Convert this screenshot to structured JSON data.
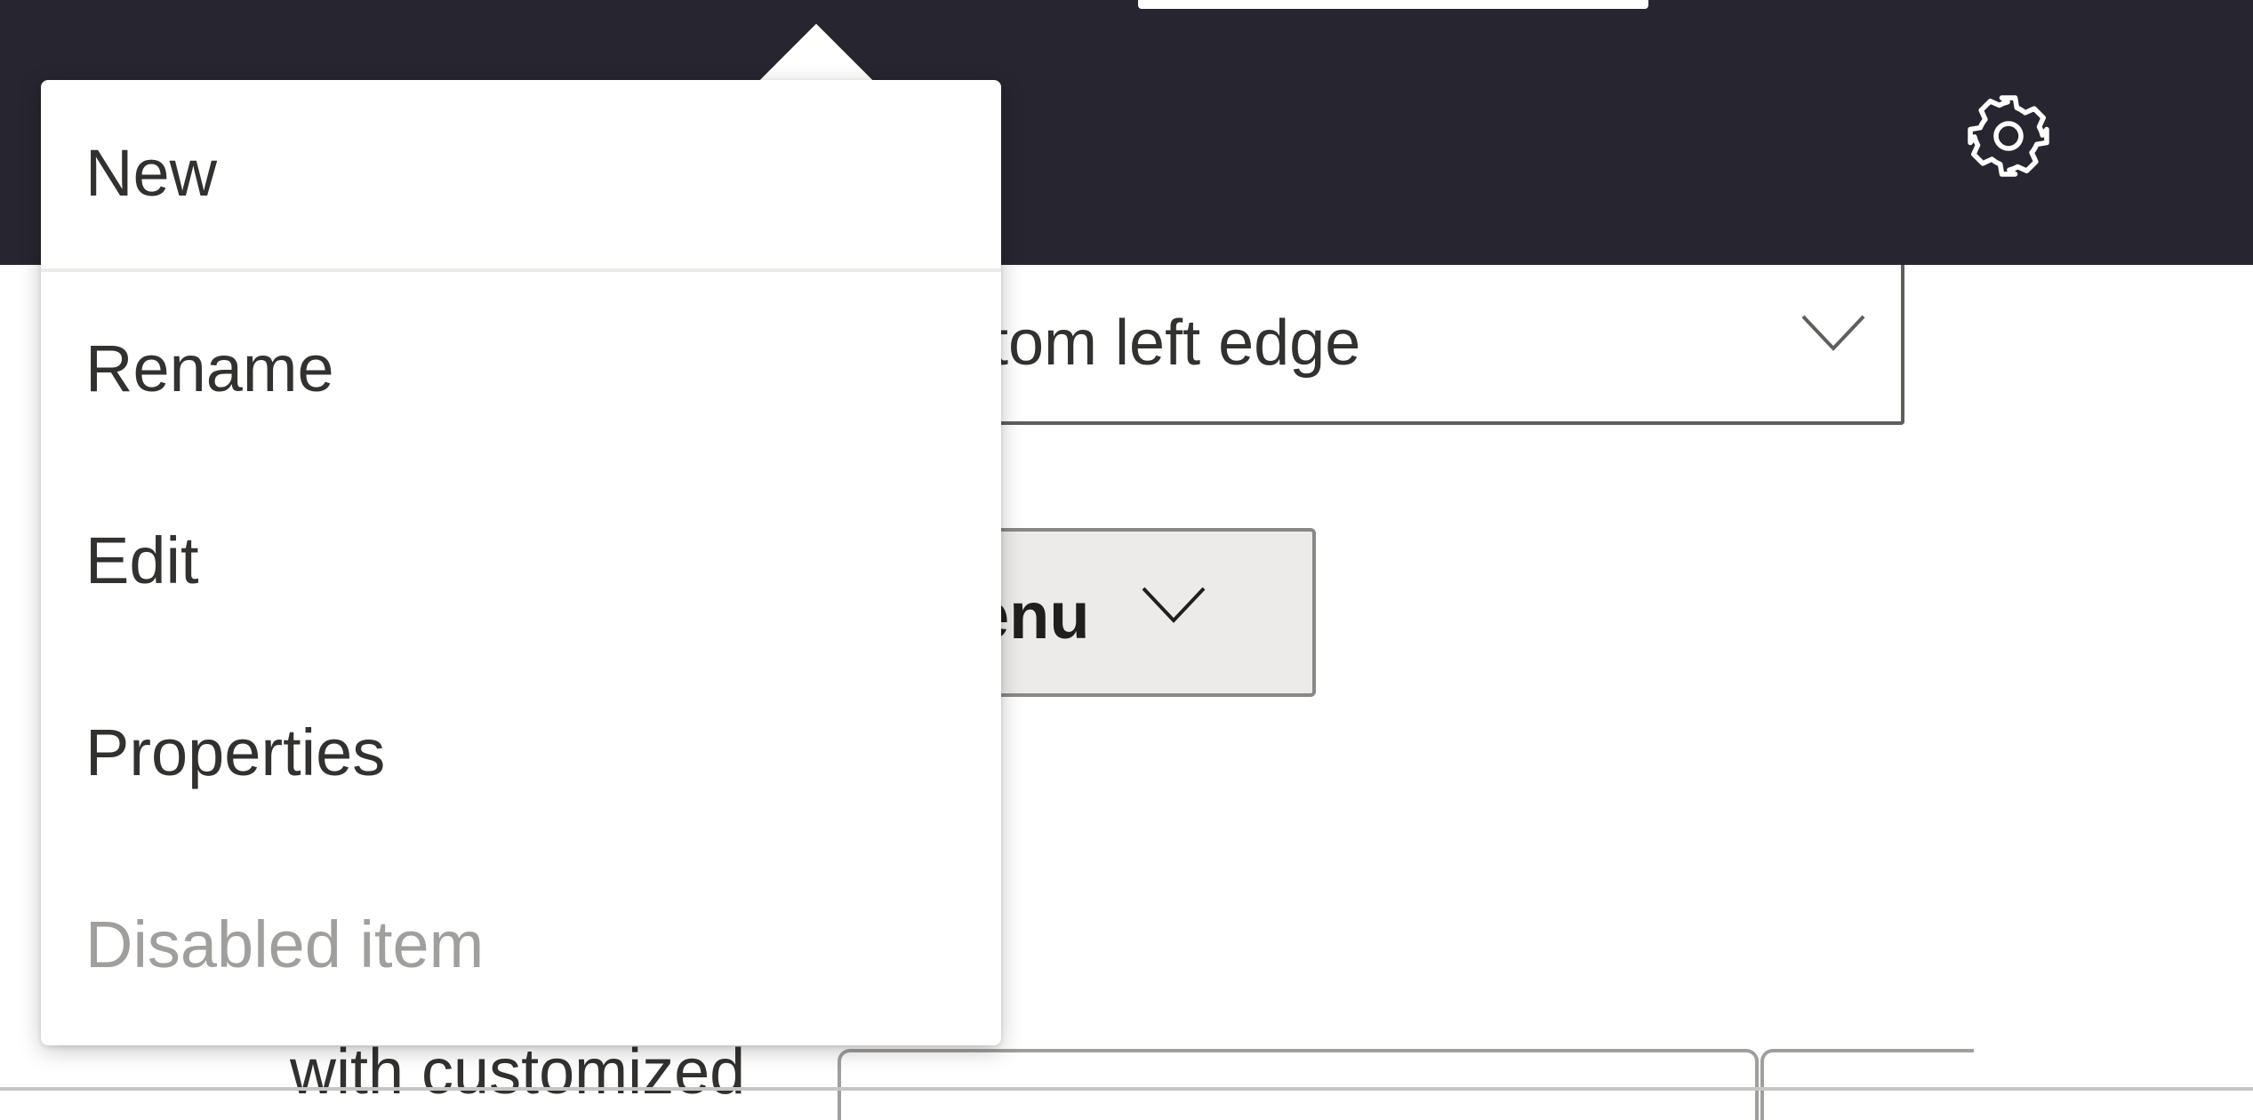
{
  "header": {
    "settings_icon": "gear-icon"
  },
  "dropdown": {
    "selected_text": "tom left edge",
    "chevron_icon": "chevron-down-icon"
  },
  "menu_button": {
    "label": "enu",
    "chevron_icon": "chevron-down-icon"
  },
  "custom_section": {
    "label": "with customized"
  },
  "context_menu": {
    "items": [
      {
        "label": "New",
        "disabled": false
      },
      {
        "label": "Rename",
        "disabled": false
      },
      {
        "label": "Edit",
        "disabled": false
      },
      {
        "label": "Properties",
        "disabled": false
      },
      {
        "label": "Disabled item",
        "disabled": true
      }
    ]
  },
  "colors": {
    "topbar": "#272630",
    "text": "#323130",
    "disabled_text": "#a19f9d",
    "button_bg": "#edebe9"
  }
}
